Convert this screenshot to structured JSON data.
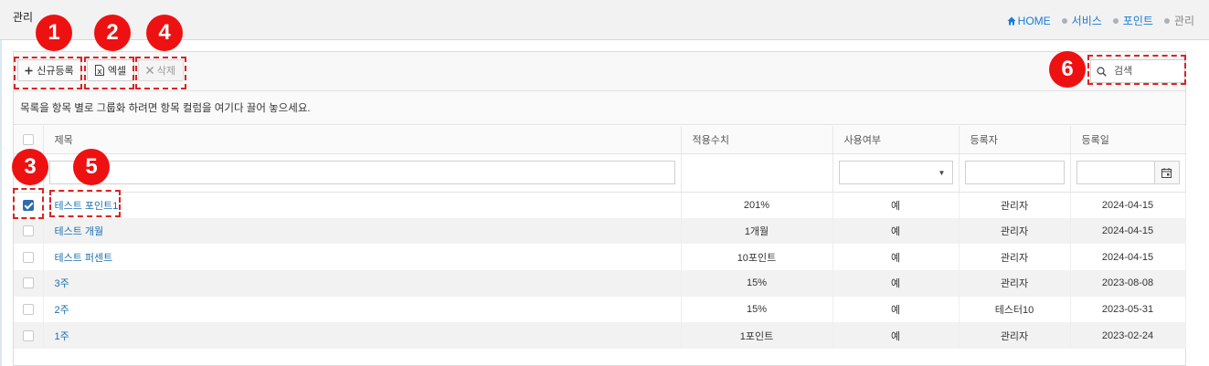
{
  "page": {
    "title": "관리"
  },
  "breadcrumb": [
    {
      "label": "HOME",
      "icon": "home-icon"
    },
    {
      "label": "서비스"
    },
    {
      "label": "포인트"
    },
    {
      "label": "관리"
    }
  ],
  "toolbar": {
    "add_label": "신규등록",
    "excel_label": "엑셀",
    "delete_label": "삭제",
    "search_placeholder": "검색"
  },
  "group_hint": "목록을 항목 별로 그룹화 하려면 항목 컬럼을 여기다 끌어 놓으세요.",
  "columns": [
    "제목",
    "적용수치",
    "사용여부",
    "등록자",
    "등록일"
  ],
  "rows": [
    {
      "checked": true,
      "title": "테스트 포인트1",
      "value": "201%",
      "used": "예",
      "author": "관리자",
      "date": "2024-04-15"
    },
    {
      "checked": false,
      "title": "테스트 개월",
      "value": "1개월",
      "used": "예",
      "author": "관리자",
      "date": "2024-04-15"
    },
    {
      "checked": false,
      "title": "테스트 퍼센트",
      "value": "10포인트",
      "used": "예",
      "author": "관리자",
      "date": "2024-04-15"
    },
    {
      "checked": false,
      "title": "3주",
      "value": "15%",
      "used": "예",
      "author": "관리자",
      "date": "2023-08-08"
    },
    {
      "checked": false,
      "title": "2주",
      "value": "15%",
      "used": "예",
      "author": "테스터10",
      "date": "2023-05-31"
    },
    {
      "checked": false,
      "title": "1주",
      "value": "1포인트",
      "used": "예",
      "author": "관리자",
      "date": "2023-02-24"
    }
  ],
  "annotations": [
    "1",
    "2",
    "3",
    "4",
    "5",
    "6"
  ],
  "colors": {
    "annotation": "#ee1111",
    "link": "#1a6fb0",
    "breadcrumb_link": "#1a7bd6",
    "checkbox_checked": "#2b6cb0"
  }
}
